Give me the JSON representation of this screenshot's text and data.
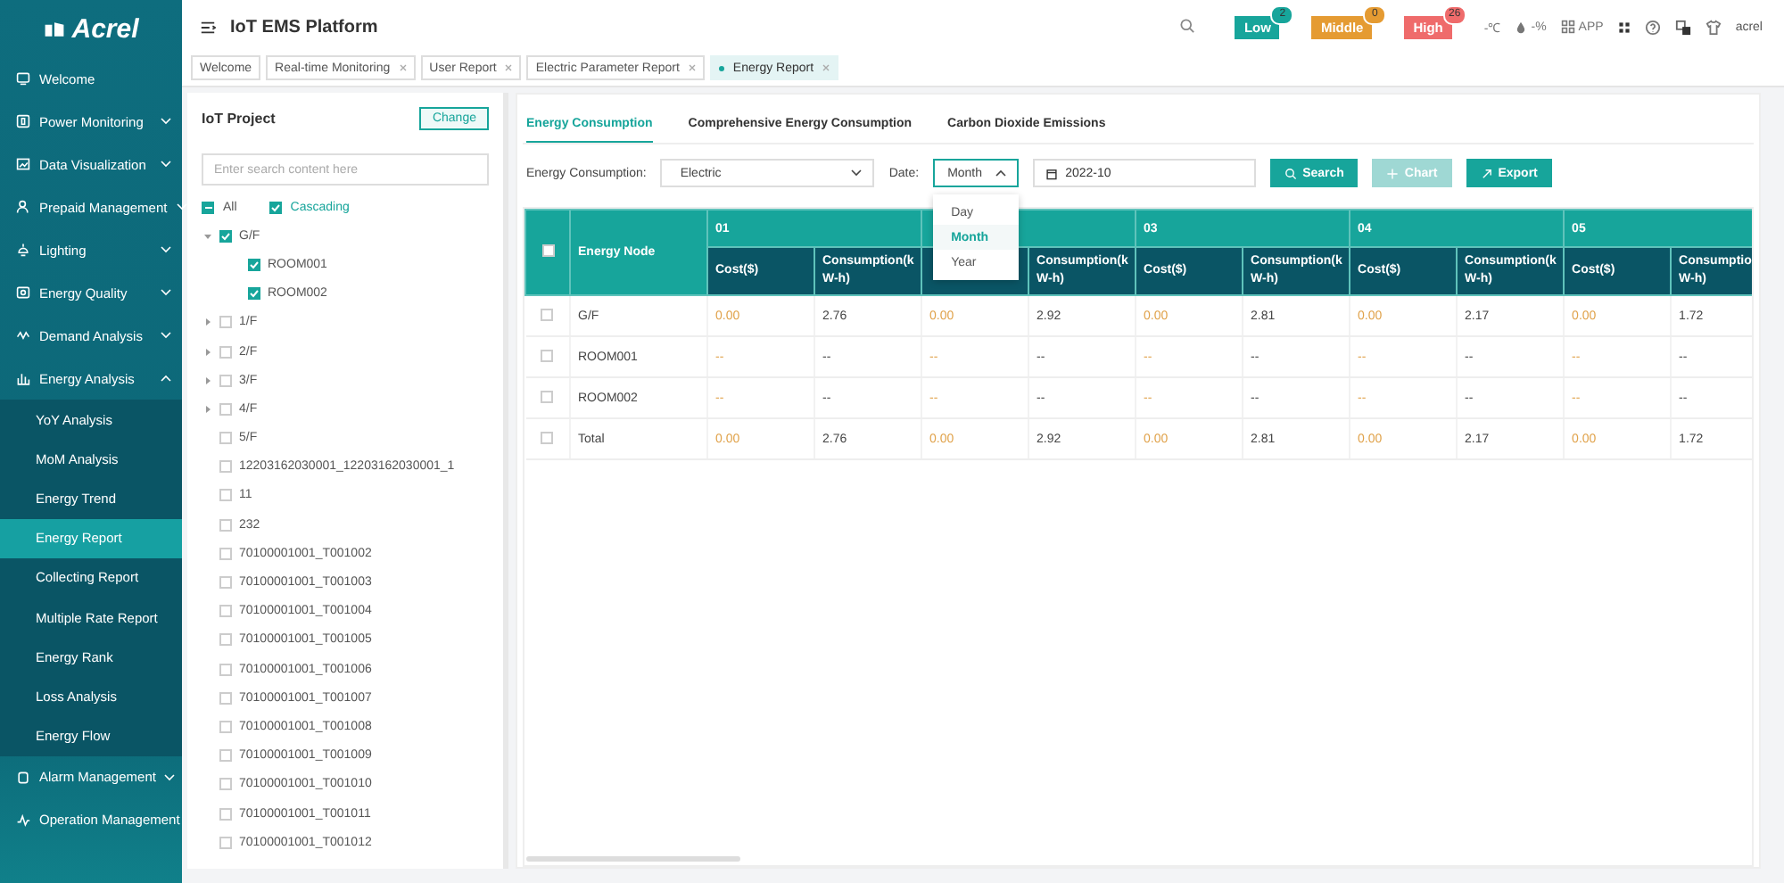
{
  "logo": {
    "text": "Acrel"
  },
  "header": {
    "title": "IoT EMS Platform",
    "alerts": [
      {
        "label": "Low",
        "count": "2",
        "color": "#17a59b"
      },
      {
        "label": "Middle",
        "count": "0",
        "color": "#e59b32"
      },
      {
        "label": "High",
        "count": "26",
        "color": "#ef6b6b"
      }
    ],
    "temperature": "-℃",
    "humidity": "-%",
    "app": "APP",
    "user": "acrel"
  },
  "page_tabs": [
    {
      "label": "Welcome",
      "closable": false,
      "selected": false
    },
    {
      "label": "Real-time Monitoring",
      "closable": true,
      "selected": false
    },
    {
      "label": "User Report",
      "closable": true,
      "selected": false
    },
    {
      "label": "Electric Parameter Report",
      "closable": true,
      "selected": false
    },
    {
      "label": "Energy Report",
      "closable": true,
      "selected": true
    }
  ],
  "sidebar": {
    "items": [
      {
        "label": "Welcome",
        "kind": "link"
      },
      {
        "label": "Power Monitoring",
        "kind": "group",
        "expanded": false
      },
      {
        "label": "Data Visualization",
        "kind": "group",
        "expanded": false
      },
      {
        "label": "Prepaid Management",
        "kind": "group",
        "expanded": false
      },
      {
        "label": "Lighting",
        "kind": "group",
        "expanded": false
      },
      {
        "label": "Energy Quality",
        "kind": "group",
        "expanded": false
      },
      {
        "label": "Demand Analysis",
        "kind": "group",
        "expanded": false
      },
      {
        "label": "Energy Analysis",
        "kind": "group",
        "expanded": true,
        "children": [
          {
            "label": "YoY Analysis",
            "selected": false
          },
          {
            "label": "MoM Analysis",
            "selected": false
          },
          {
            "label": "Energy Trend",
            "selected": false
          },
          {
            "label": "Energy Report",
            "selected": true
          },
          {
            "label": "Collecting Report",
            "selected": false
          },
          {
            "label": "Multiple Rate Report",
            "selected": false
          },
          {
            "label": "Energy Rank",
            "selected": false
          },
          {
            "label": "Loss Analysis",
            "selected": false
          },
          {
            "label": "Energy Flow",
            "selected": false
          }
        ]
      },
      {
        "label": "Alarm Management",
        "kind": "group",
        "expanded": false
      },
      {
        "label": "Operation Management",
        "kind": "link"
      }
    ]
  },
  "project": {
    "title": "IoT Project",
    "change_button": "Change",
    "search": {
      "placeholder": "Enter search content here"
    },
    "all": {
      "label": "All",
      "indeterminate": true
    },
    "cascading": {
      "label": "Cascading",
      "checked": true
    },
    "tree": [
      {
        "label": "G/F",
        "kind": "branch",
        "expanded": true,
        "checked": true,
        "children": [
          {
            "label": "ROOM001",
            "kind": "leaf",
            "checked": true
          },
          {
            "label": "ROOM002",
            "kind": "leaf",
            "checked": true
          }
        ]
      },
      {
        "label": "1/F",
        "kind": "branch",
        "expanded": false,
        "checked": false
      },
      {
        "label": "2/F",
        "kind": "branch",
        "expanded": false,
        "checked": false
      },
      {
        "label": "3/F",
        "kind": "branch",
        "expanded": false,
        "checked": false
      },
      {
        "label": "4/F",
        "kind": "branch",
        "expanded": false,
        "checked": false
      },
      {
        "label": "5/F",
        "kind": "leaf",
        "checked": false
      },
      {
        "label": "12203162030001_12203162030001_1",
        "kind": "leaf",
        "checked": false
      },
      {
        "label": "11",
        "kind": "leaf",
        "checked": false
      },
      {
        "label": "232",
        "kind": "leaf",
        "checked": false
      },
      {
        "label": "70100001001_T001002",
        "kind": "leaf",
        "checked": false
      },
      {
        "label": "70100001001_T001003",
        "kind": "leaf",
        "checked": false
      },
      {
        "label": "70100001001_T001004",
        "kind": "leaf",
        "checked": false
      },
      {
        "label": "70100001001_T001005",
        "kind": "leaf",
        "checked": false
      },
      {
        "label": "70100001001_T001006",
        "kind": "leaf",
        "checked": false
      },
      {
        "label": "70100001001_T001007",
        "kind": "leaf",
        "checked": false
      },
      {
        "label": "70100001001_T001008",
        "kind": "leaf",
        "checked": false
      },
      {
        "label": "70100001001_T001009",
        "kind": "leaf",
        "checked": false
      },
      {
        "label": "70100001001_T001010",
        "kind": "leaf",
        "checked": false
      },
      {
        "label": "70100001001_T001011",
        "kind": "leaf",
        "checked": false
      },
      {
        "label": "70100001001_T001012",
        "kind": "leaf",
        "checked": false
      }
    ]
  },
  "report": {
    "tabs": [
      {
        "label": "Energy Consumption",
        "selected": true
      },
      {
        "label": "Comprehensive Energy Consumption",
        "selected": false
      },
      {
        "label": "Carbon Dioxide Emissions",
        "selected": false
      }
    ],
    "filter": {
      "type_label": "Energy Consumption:",
      "type_value": "Electric",
      "date_label": "Date:",
      "period": "Month",
      "period_open": true,
      "date_value": "2022-10"
    },
    "period_options": [
      {
        "label": "Day",
        "selected": false
      },
      {
        "label": "Month",
        "selected": true
      },
      {
        "label": "Year",
        "selected": false
      }
    ],
    "buttons": [
      {
        "label": "Search",
        "kind": "search",
        "disabled": false
      },
      {
        "label": "Chart",
        "kind": "chart",
        "disabled": true
      },
      {
        "label": "Export",
        "kind": "export",
        "disabled": false
      }
    ],
    "table": {
      "select_all_checked": false,
      "node_header": "Energy Node",
      "groups": [
        {
          "label": "01",
          "columns": [
            {
              "kind": "cost",
              "label": "Cost($)"
            },
            {
              "kind": "consumption",
              "label": "Consumption(k W-h)"
            }
          ]
        },
        {
          "columns": [
            {
              "kind": "cost"
            },
            {
              "kind": "consumption",
              "label": "Consumption(k W-h)"
            }
          ]
        },
        {
          "label": "03",
          "columns": [
            {
              "kind": "cost",
              "label": "Cost($)"
            },
            {
              "kind": "consumption",
              "label": "Consumption(k W-h)"
            }
          ]
        },
        {
          "label": "04",
          "columns": [
            {
              "kind": "cost",
              "label": "Cost($)"
            },
            {
              "kind": "consumption",
              "label": "Consumption(k W-h)"
            }
          ]
        },
        {
          "label": "05",
          "columns": [
            {
              "kind": "cost",
              "label": "Cost($)"
            },
            {
              "kind": "consumption",
              "label": "Consumptio W-h)"
            }
          ]
        }
      ],
      "rows": [
        {
          "node": "G/F",
          "checked": false,
          "values": [
            "0.00",
            "2.76",
            "0.00",
            "2.92",
            "0.00",
            "2.81",
            "0.00",
            "2.17",
            "0.00",
            "1.72"
          ]
        },
        {
          "node": "ROOM001",
          "checked": false,
          "values": [
            "--",
            "--",
            "--",
            "--",
            "--",
            "--",
            "--",
            "--",
            "--",
            "--"
          ]
        },
        {
          "node": "ROOM002",
          "checked": false,
          "values": [
            "--",
            "--",
            "--",
            "--",
            "--",
            "--",
            "--",
            "--",
            "--",
            "--"
          ]
        },
        {
          "node": "Total",
          "checked": false,
          "values": [
            "0.00",
            "2.76",
            "0.00",
            "2.92",
            "0.00",
            "2.81",
            "0.00",
            "2.17",
            "0.00",
            "1.72"
          ]
        }
      ]
    }
  }
}
